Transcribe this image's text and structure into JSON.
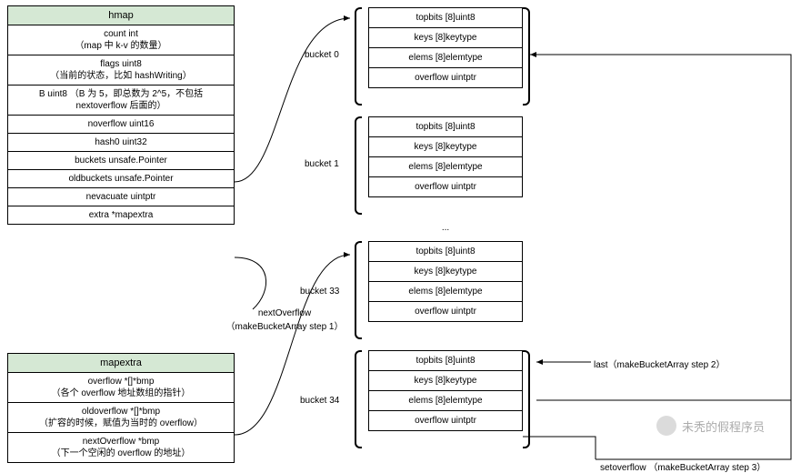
{
  "hmap": {
    "title": "hmap",
    "rows": [
      "count int\n（map 中 k-v 的数量）",
      "flags uint8\n（当前的状态，比如 hashWriting）",
      "B uint8 （B 为 5，即总数为 2^5，不包括 nextoverflow 后面的）",
      "noverflow uint16",
      "hash0 uint32",
      "buckets unsafe.Pointer",
      "oldbuckets unsafe.Pointer",
      "nevacuate uintptr",
      "extra *mapextra"
    ]
  },
  "mapextra": {
    "title": "mapextra",
    "rows": [
      "overflow *[]*bmp\n（各个 overflow 地址数组的指针）",
      "oldoverflow *[]*bmp\n（扩容的时候，赋值为当时的 overflow）",
      "nextOverflow *bmp\n（下一个空闲的 overflow 的地址）"
    ]
  },
  "bucketLabels": {
    "b0": "bucket 0",
    "b1": "bucket 1",
    "b33": "bucket 33",
    "b34": "bucket 34"
  },
  "bucketFields": {
    "topbits": "topbits [8]uint8",
    "keys": "keys [8]keytype",
    "elems": "elems [8]elemtype",
    "overflow": "overflow uintptr"
  },
  "dots": "...",
  "annotations": {
    "nextOverflow": "nextOverflow\n（makeBucketArray step 1）",
    "last": "last（makeBucketArray step 2）",
    "setoverflow": "setoverflow （makeBucketArray step 3）"
  },
  "watermark": "未秃的假程序员"
}
